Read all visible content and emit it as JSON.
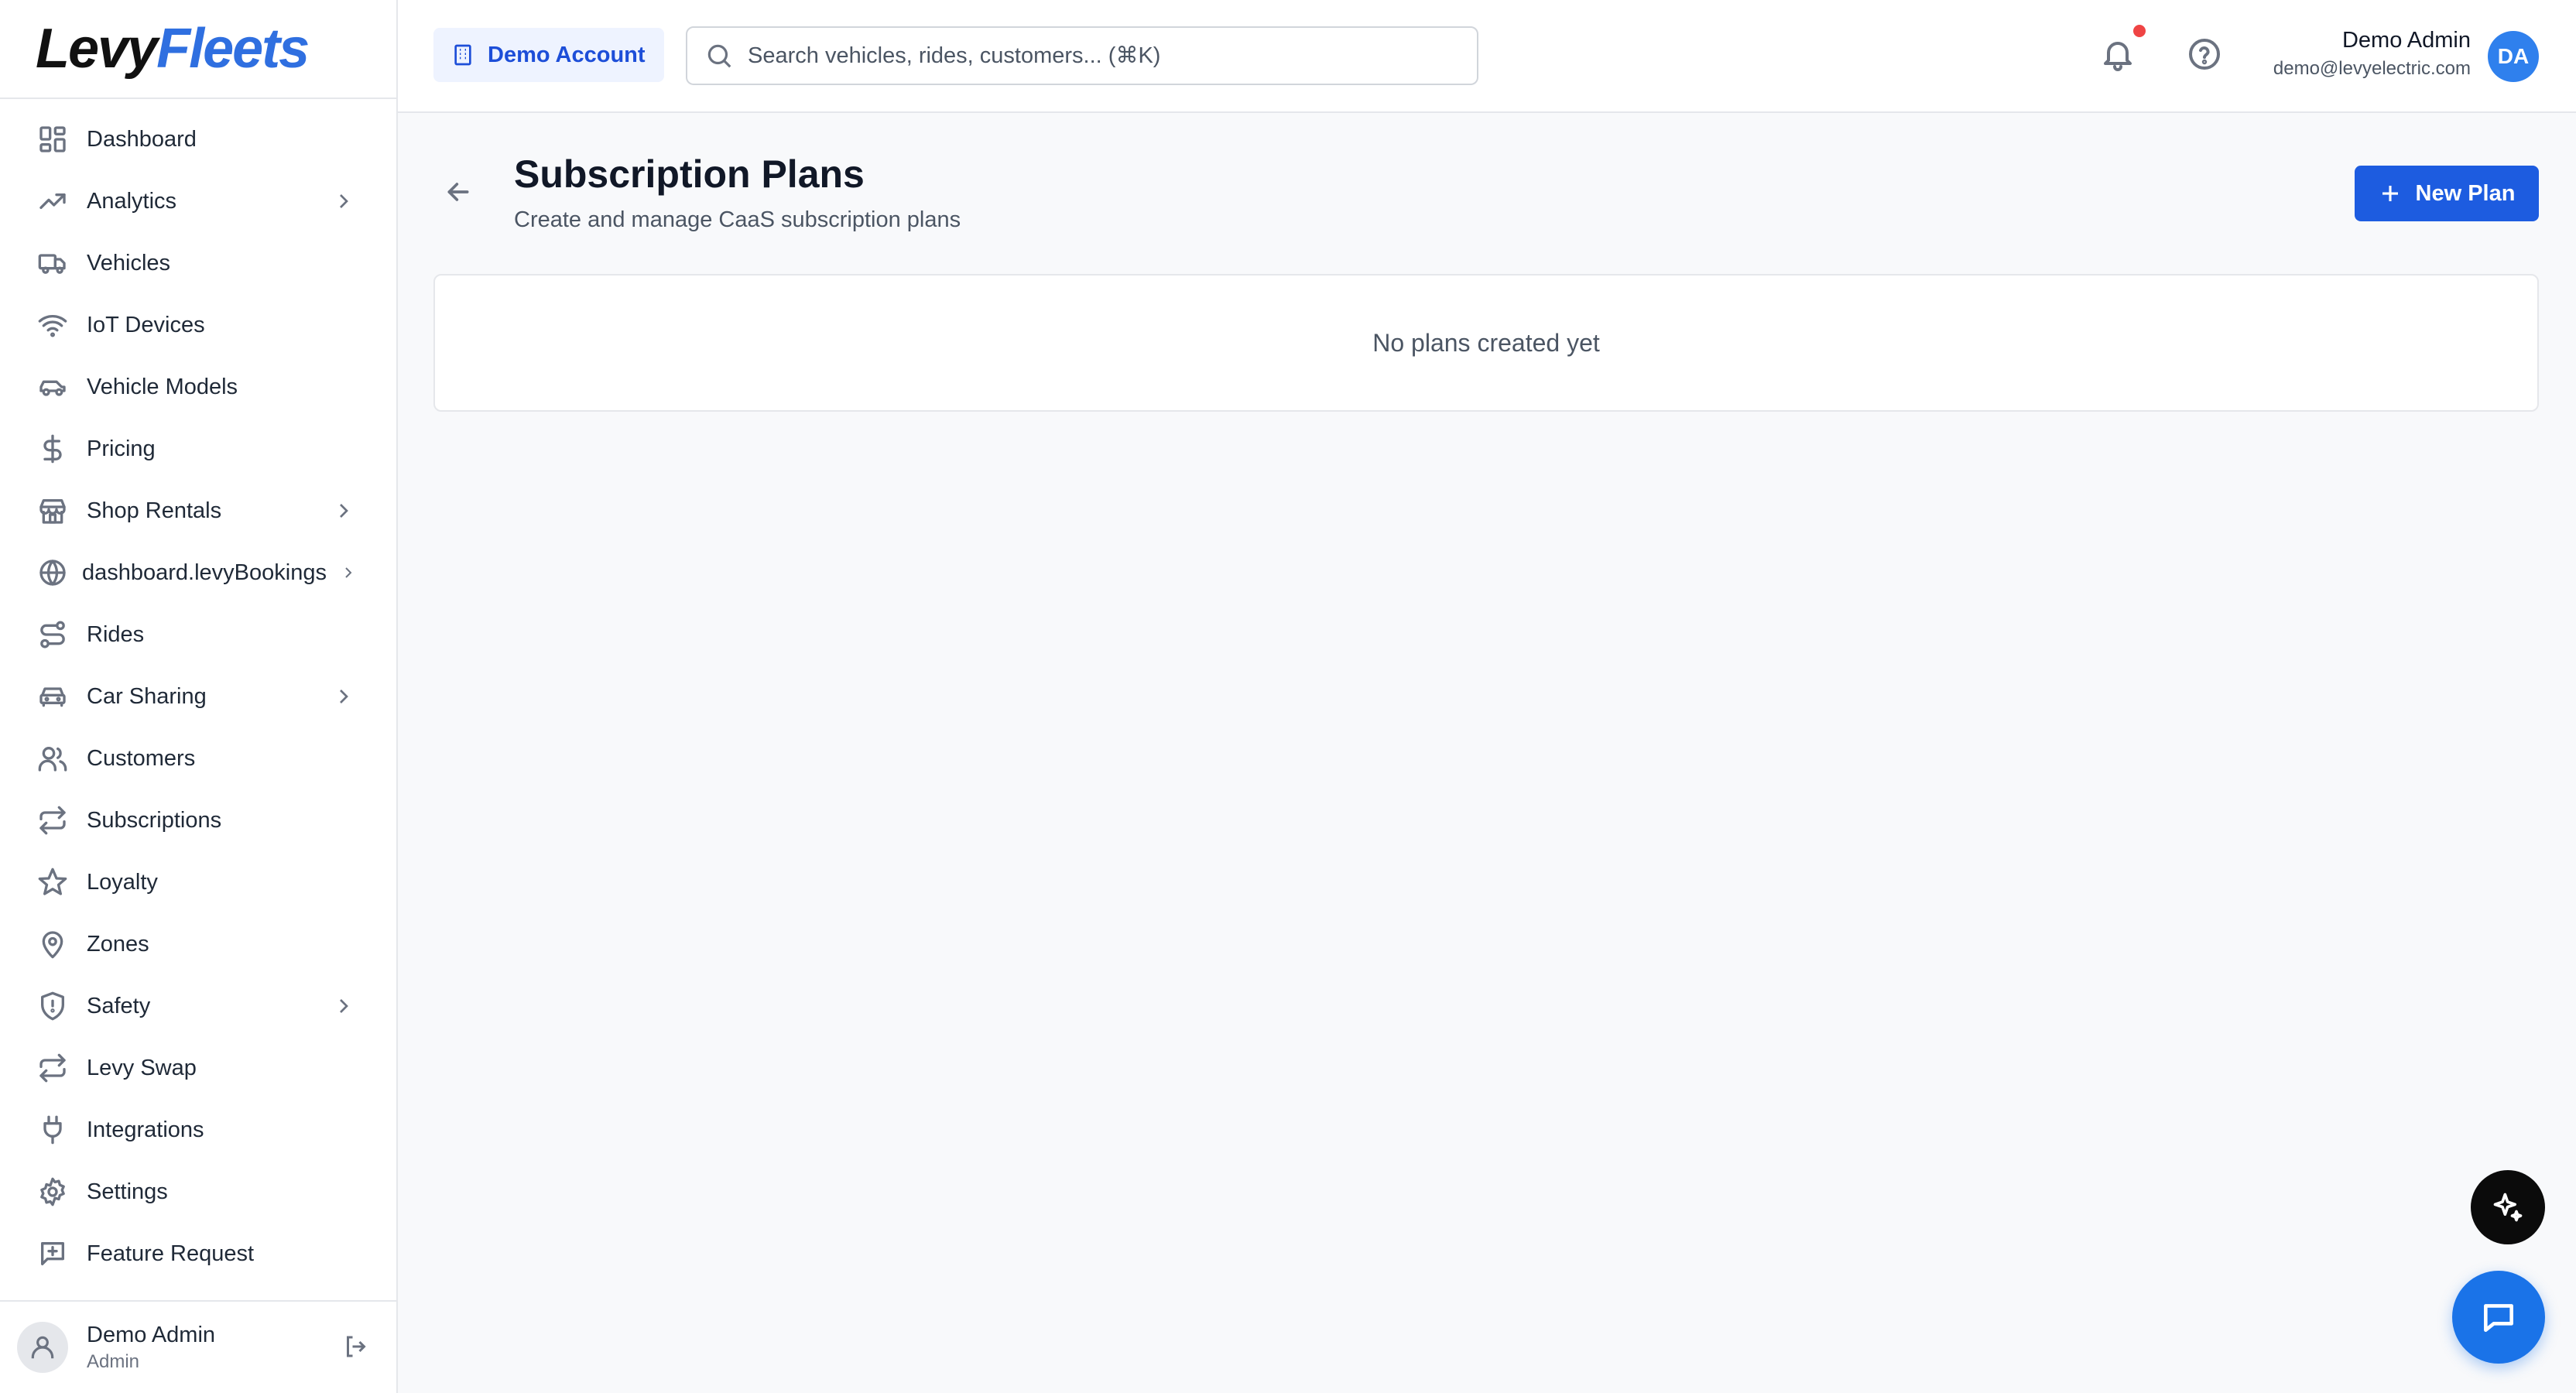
{
  "brand": {
    "logo_part1": "Levy",
    "logo_part2": "Fleets"
  },
  "colors": {
    "accent": "#1d5ce0",
    "brand_blue": "#2f6fe0",
    "notification": "#ef4444",
    "avatar": "#2f80ed"
  },
  "sidebar": {
    "items": [
      {
        "label": "Dashboard",
        "icon": "grid-icon",
        "has_submenu": false
      },
      {
        "label": "Analytics",
        "icon": "trending-up-icon",
        "has_submenu": true
      },
      {
        "label": "Vehicles",
        "icon": "truck-icon",
        "has_submenu": false
      },
      {
        "label": "IoT Devices",
        "icon": "wifi-icon",
        "has_submenu": false
      },
      {
        "label": "Vehicle Models",
        "icon": "car-icon",
        "has_submenu": false
      },
      {
        "label": "Pricing",
        "icon": "dollar-icon",
        "has_submenu": false
      },
      {
        "label": "Shop Rentals",
        "icon": "store-icon",
        "has_submenu": true
      },
      {
        "label": "dashboard.levyBookings",
        "icon": "globe-icon",
        "has_submenu": true
      },
      {
        "label": "Rides",
        "icon": "route-icon",
        "has_submenu": false
      },
      {
        "label": "Car Sharing",
        "icon": "car-front-icon",
        "has_submenu": true
      },
      {
        "label": "Customers",
        "icon": "users-icon",
        "has_submenu": false
      },
      {
        "label": "Subscriptions",
        "icon": "repeat-icon",
        "has_submenu": false
      },
      {
        "label": "Loyalty",
        "icon": "star-icon",
        "has_submenu": false
      },
      {
        "label": "Zones",
        "icon": "map-pin-icon",
        "has_submenu": false
      },
      {
        "label": "Safety",
        "icon": "shield-icon",
        "has_submenu": true
      },
      {
        "label": "Levy Swap",
        "icon": "swap-icon",
        "has_submenu": false
      },
      {
        "label": "Integrations",
        "icon": "plug-icon",
        "has_submenu": false
      },
      {
        "label": "Settings",
        "icon": "gear-icon",
        "has_submenu": false
      },
      {
        "label": "Feature Request",
        "icon": "message-plus-icon",
        "has_submenu": false
      }
    ],
    "footer": {
      "name": "Demo Admin",
      "role": "Admin"
    }
  },
  "header": {
    "account_label": "Demo Account",
    "search_placeholder": "Search vehicles, rides, customers... (⌘K)",
    "search_value": "",
    "user": {
      "name": "Demo Admin",
      "email": "demo@levyelectric.com",
      "initials": "DA"
    }
  },
  "main": {
    "title": "Subscription Plans",
    "subtitle": "Create and manage CaaS subscription plans",
    "new_plan_label": "New Plan",
    "empty_message": "No plans created yet"
  }
}
